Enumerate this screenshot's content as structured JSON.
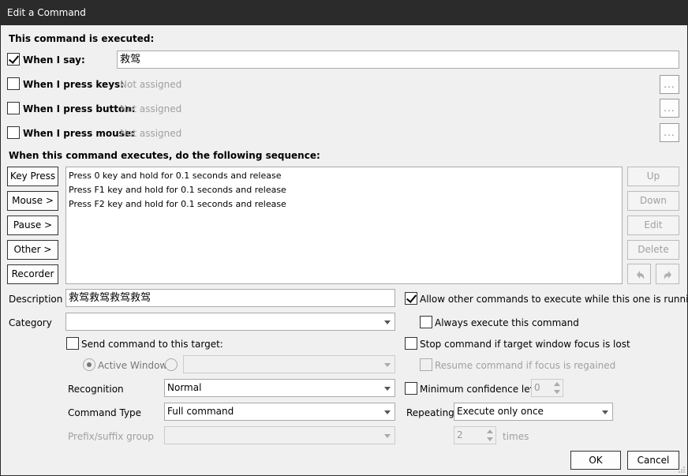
{
  "window": {
    "title": "Edit a Command"
  },
  "executed_header": "This command is executed:",
  "triggers": {
    "say": {
      "label": "When I say:",
      "checked": true,
      "value": "救驾"
    },
    "keys": {
      "label": "When I press keys:",
      "checked": false,
      "placeholder": "Not assigned",
      "button": "..."
    },
    "button": {
      "label": "When I press button:",
      "checked": false,
      "placeholder": "Not assigned",
      "button": "..."
    },
    "mouse": {
      "label": "When I press mouse:",
      "checked": false,
      "placeholder": "Not assigned",
      "button": "..."
    }
  },
  "sequence_header": "When this command executes, do the following sequence:",
  "action_buttons": [
    "Key Press",
    "Mouse >",
    "Pause >",
    "Other >",
    "Recorder"
  ],
  "sequence": [
    "Press 0 key and hold for 0.1 seconds and release",
    "Press F1 key and hold for 0.1 seconds and release",
    "Press F2 key and hold for 0.1 seconds and release"
  ],
  "list_buttons": [
    "Up",
    "Down",
    "Edit",
    "Delete"
  ],
  "icons": {
    "undo": "undo-icon",
    "redo": "redo-icon"
  },
  "description": {
    "label": "Description",
    "value": "救驾救驾救驾救驾"
  },
  "category": {
    "label": "Category",
    "value": ""
  },
  "send_target": {
    "label": "Send command to this target:",
    "checked": false,
    "active_window": "Active Window",
    "window_value": ""
  },
  "recognition": {
    "label": "Recognition",
    "value": "Normal"
  },
  "command_type": {
    "label": "Command Type",
    "value": "Full command"
  },
  "prefix_suffix": {
    "label": "Prefix/suffix group",
    "value": ""
  },
  "options": {
    "allow_other": {
      "label": "Allow other commands to execute while this one is running",
      "checked": true
    },
    "always_execute": {
      "label": "Always execute this command",
      "checked": false
    },
    "stop_focus": {
      "label": "Stop command if target window focus is lost",
      "checked": false
    },
    "resume_focus": {
      "label": "Resume command if focus is regained",
      "checked": false
    },
    "min_confidence": {
      "label": "Minimum confidence level",
      "checked": false,
      "value": "0"
    }
  },
  "repeating": {
    "label": "Repeating",
    "value": "Execute only once",
    "times_value": "2",
    "times_label": "times"
  },
  "footer": {
    "ok": "OK",
    "cancel": "Cancel"
  }
}
